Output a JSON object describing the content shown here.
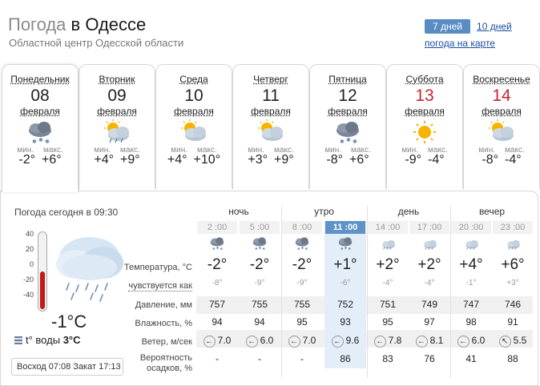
{
  "header": {
    "title_prefix": "Погода",
    "title_city": " в Одессе",
    "subtitle": "Областной центр Одесской области",
    "period_active": "7 дней",
    "period_link": "10 дней",
    "map_link": "погода на карте"
  },
  "days": [
    {
      "name": "Понедельник",
      "num": "08",
      "month": "февраля",
      "min_label": "мин.",
      "max_label": "макс.",
      "min": "-2°",
      "max": "+6°",
      "icon": "cloud-snow-icon",
      "weekend": false
    },
    {
      "name": "Вторник",
      "num": "09",
      "month": "февраля",
      "min_label": "мин.",
      "max_label": "макс.",
      "min": "+4°",
      "max": "+9°",
      "icon": "sun-cloud-rain-icon",
      "weekend": false
    },
    {
      "name": "Среда",
      "num": "10",
      "month": "февраля",
      "min_label": "мин.",
      "max_label": "макс.",
      "min": "+4°",
      "max": "+10°",
      "icon": "sun-cloud-icon",
      "weekend": false
    },
    {
      "name": "Четверг",
      "num": "11",
      "month": "февраля",
      "min_label": "мин.",
      "max_label": "макс.",
      "min": "+3°",
      "max": "+9°",
      "icon": "sun-cloud-icon",
      "weekend": false
    },
    {
      "name": "Пятница",
      "num": "12",
      "month": "февраля",
      "min_label": "мин.",
      "max_label": "макс.",
      "min": "-8°",
      "max": "+6°",
      "icon": "cloud-snow-icon",
      "weekend": false
    },
    {
      "name": "Суббота",
      "num": "13",
      "month": "февраля",
      "min_label": "мин.",
      "max_label": "макс.",
      "min": "-9°",
      "max": "-4°",
      "icon": "sun-icon",
      "weekend": true
    },
    {
      "name": "Воскресенье",
      "num": "14",
      "month": "февраля",
      "min_label": "мин.",
      "max_label": "макс.",
      "min": "-8°",
      "max": "-4°",
      "icon": "sun-cloud-icon",
      "weekend": true
    }
  ],
  "now": {
    "label": "Погода сегодня в 09:30",
    "scale": [
      "40",
      "20",
      "0",
      "-20",
      "-40"
    ],
    "thermometer_value": -1,
    "temp": "-1°C",
    "water_label": "t° воды",
    "water_temp": "3°C",
    "sunrise_label": "Восход",
    "sunrise": "07:08",
    "sunset_label": "Закат",
    "sunset": "17:13"
  },
  "parts": [
    "ночь",
    "утро",
    "день",
    "вечер"
  ],
  "hours": [
    "2 :00",
    "5 :00",
    "8 :00",
    "11 :00",
    "14 :00",
    "17 :00",
    "20 :00",
    "23 :00"
  ],
  "active_hour_index": 3,
  "hour_icons": [
    "cloud-snow-icon",
    "cloud-snow-icon",
    "cloud-snow-icon",
    "cloud-snow-icon",
    "cloud-rain-icon",
    "cloud-rain-icon",
    "cloud-rain-icon",
    "cloud-rain-icon"
  ],
  "labels": {
    "temperature": "Температура, °C",
    "feels": "чувствуется как",
    "pressure": "Давление, мм",
    "humidity": "Влажность, %",
    "wind": "Ветер, м/сек",
    "precip_1": "Вероятность",
    "precip_2": "осадков, %"
  },
  "temps": [
    "-2°",
    "-2°",
    "-2°",
    "+1°",
    "+2°",
    "+2°",
    "+4°",
    "+6°"
  ],
  "feels": [
    "-8°",
    "-9°",
    "-9°",
    "-6°",
    "-4°",
    "-4°",
    "-1°",
    "+3°"
  ],
  "pressure": [
    "757",
    "755",
    "755",
    "752",
    "751",
    "749",
    "747",
    "746"
  ],
  "humidity": [
    "94",
    "94",
    "95",
    "93",
    "95",
    "97",
    "98",
    "91"
  ],
  "wind": [
    "7.0",
    "6.0",
    "7.0",
    "9.6",
    "7.8",
    "8.1",
    "6.0",
    "5.5"
  ],
  "wind_dirs": [
    "←",
    "←",
    "←",
    "←",
    "←",
    "←",
    "←",
    "↖"
  ],
  "precip": [
    "-",
    "-",
    "-",
    "86",
    "83",
    "76",
    "41",
    "88"
  ],
  "colors": {
    "weekend": "#c6262e",
    "accent": "#5a8cc4",
    "link": "#1a4fa0"
  }
}
